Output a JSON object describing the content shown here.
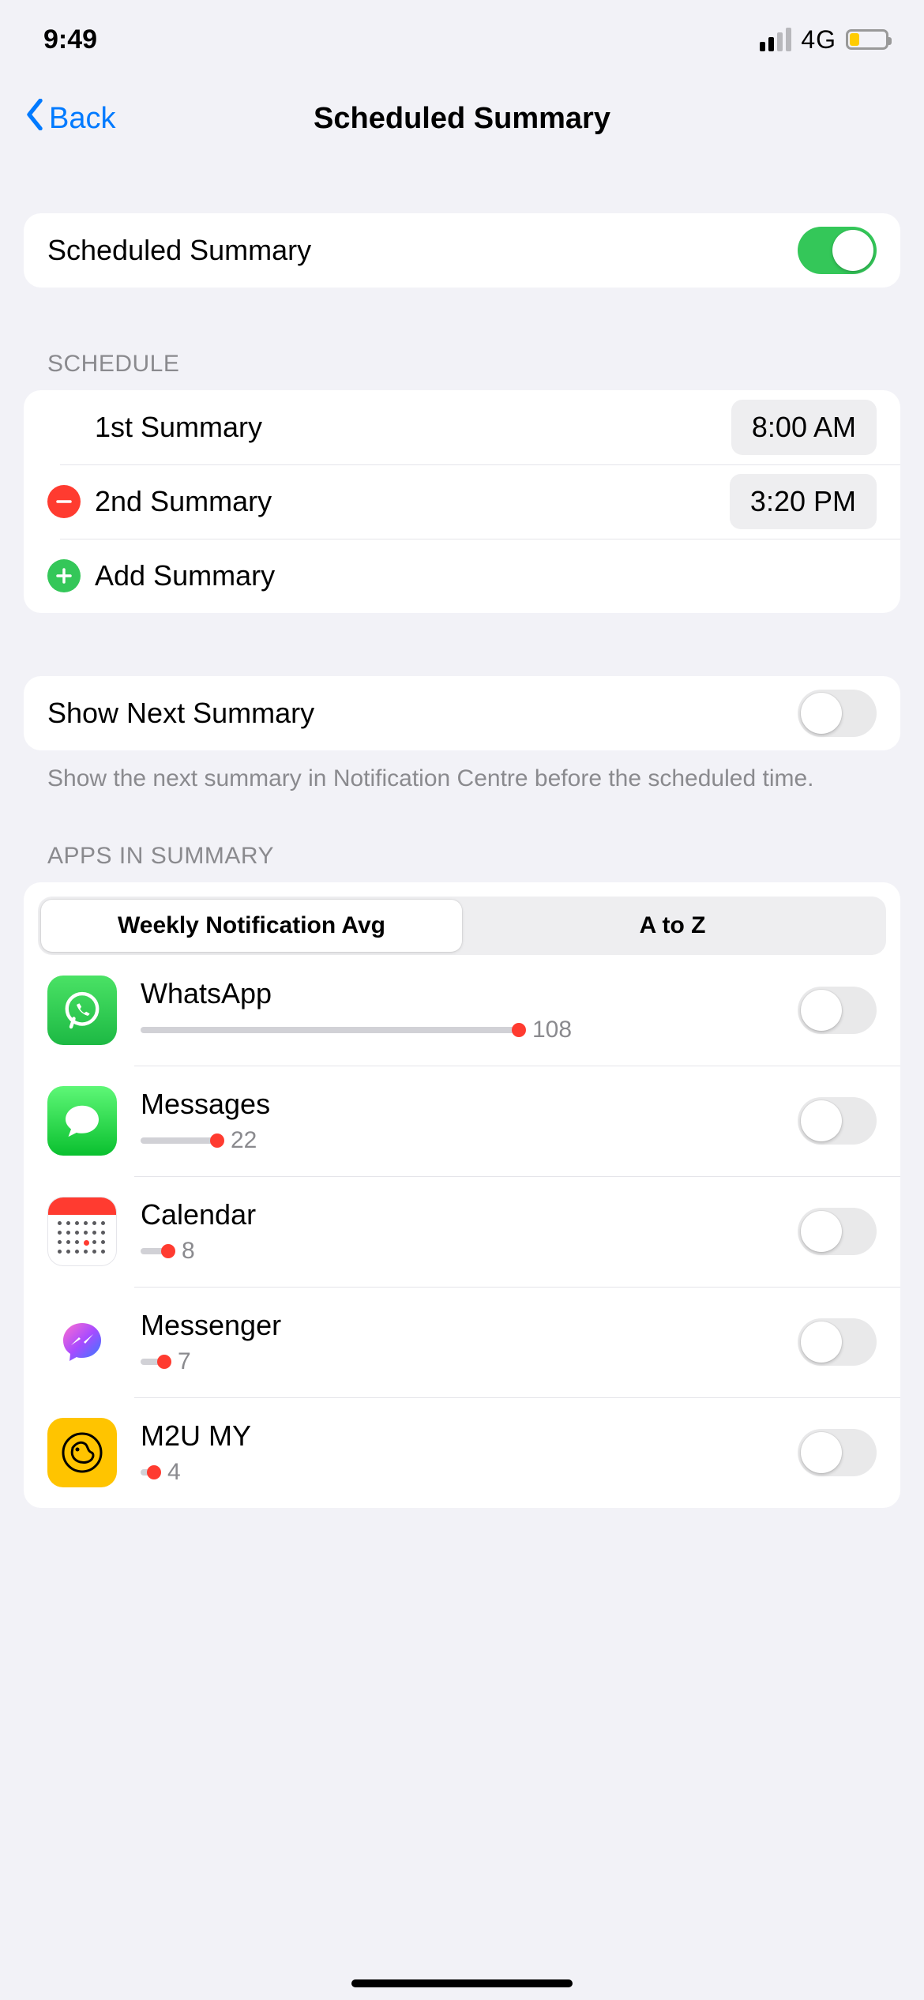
{
  "status": {
    "time": "9:49",
    "network": "4G"
  },
  "nav": {
    "back": "Back",
    "title": "Scheduled Summary"
  },
  "main_toggle": {
    "label": "Scheduled Summary",
    "on": true
  },
  "schedule": {
    "header": "SCHEDULE",
    "items": [
      {
        "label": "1st Summary",
        "time": "8:00 AM",
        "removable": false
      },
      {
        "label": "2nd Summary",
        "time": "3:20 PM",
        "removable": true
      }
    ],
    "add_label": "Add Summary"
  },
  "next_summary": {
    "label": "Show Next Summary",
    "on": false,
    "footer": "Show the next summary in Notification Centre before the scheduled time."
  },
  "apps": {
    "header": "APPS IN SUMMARY",
    "sort_options": [
      "Weekly Notification Avg",
      "A to Z"
    ],
    "sort_selected": 0,
    "max_count": 108,
    "list": [
      {
        "name": "WhatsApp",
        "count": 108,
        "on": false,
        "icon": "whatsapp"
      },
      {
        "name": "Messages",
        "count": 22,
        "on": false,
        "icon": "messages"
      },
      {
        "name": "Calendar",
        "count": 8,
        "on": false,
        "icon": "calendar"
      },
      {
        "name": "Messenger",
        "count": 7,
        "on": false,
        "icon": "messenger"
      },
      {
        "name": "M2U MY",
        "count": 4,
        "on": false,
        "icon": "m2u"
      }
    ]
  }
}
